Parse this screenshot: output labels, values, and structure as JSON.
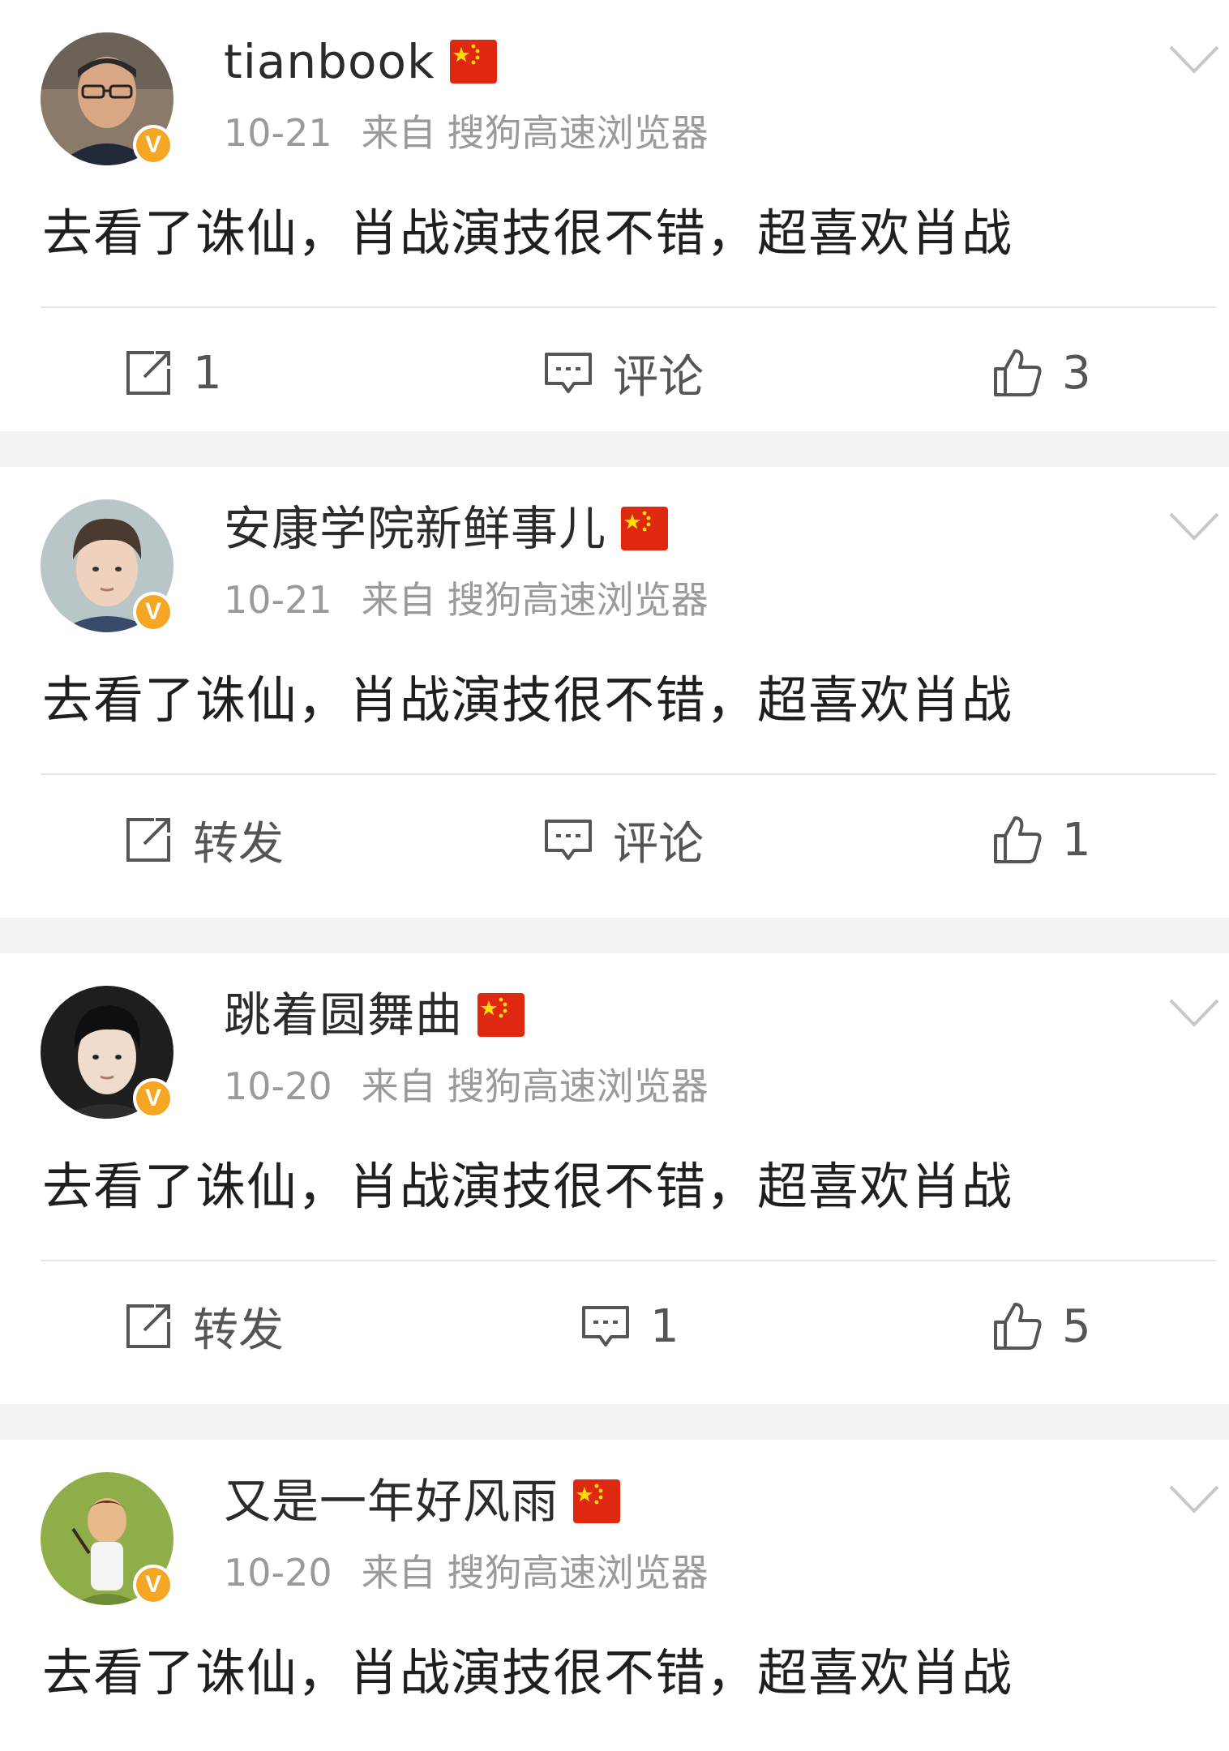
{
  "labels": {
    "repost": "转发",
    "comment": "评论",
    "from": "来自",
    "flag_icon": "china-flag-icon",
    "badge": "V"
  },
  "icons": {
    "repost": "repost-icon",
    "comment": "comment-icon",
    "like": "thumbs-up-icon",
    "more": "chevron-down-icon",
    "verified": "verified-badge-icon"
  },
  "colors": {
    "badge": "#f5a623",
    "flag_red": "#de2910",
    "flag_star": "#ffde00",
    "text": "#1f1f1f",
    "meta": "#9a9a9a",
    "separator": "#f2f2f2"
  },
  "posts": [
    {
      "username": "tianbook",
      "date": "10-21",
      "from": "来自",
      "source": "搜狗高速浏览器",
      "content": "去看了诛仙，肖战演技很不错，超喜欢肖战",
      "repost": "1",
      "comment": "评论",
      "like": "3"
    },
    {
      "username": "安康学院新鲜事儿",
      "date": "10-21",
      "from": "来自",
      "source": "搜狗高速浏览器",
      "content": "去看了诛仙，肖战演技很不错，超喜欢肖战",
      "repost": "转发",
      "comment": "评论",
      "like": "1"
    },
    {
      "username": "跳着圆舞曲",
      "date": "10-20",
      "from": "来自",
      "source": "搜狗高速浏览器",
      "content": "去看了诛仙，肖战演技很不错，超喜欢肖战",
      "repost": "转发",
      "comment": "1",
      "like": "5"
    },
    {
      "username": "又是一年好风雨",
      "date": "10-20",
      "from": "来自",
      "source": "搜狗高速浏览器",
      "content": "去看了诛仙，肖战演技很不错，超喜欢肖战"
    }
  ]
}
